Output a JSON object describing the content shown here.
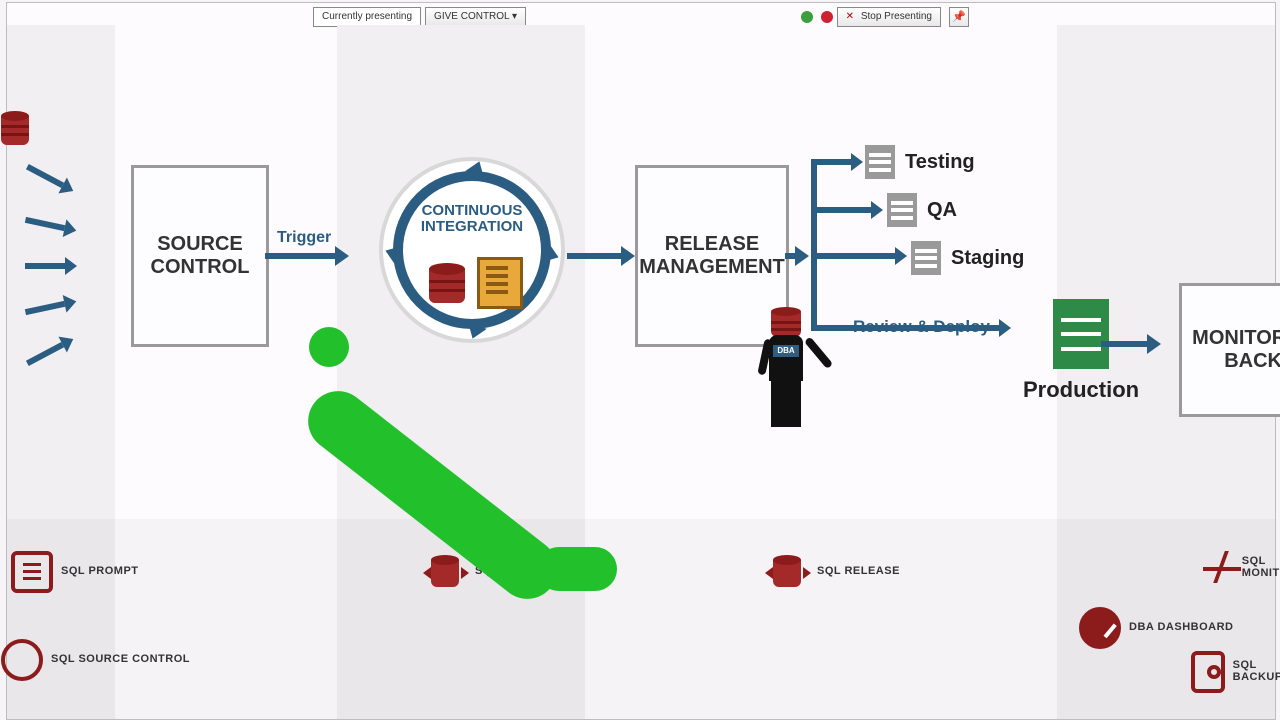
{
  "toolbar": {
    "status": "Currently presenting",
    "give_control": "GIVE CONTROL",
    "stop": "Stop Presenting",
    "close_glyph": "✕",
    "pin_glyph": "📌"
  },
  "labels": {
    "trigger": "Trigger",
    "review_deploy": "Review & Deploy",
    "dba_tag": "DBA"
  },
  "nodes": {
    "source_control": "SOURCE CONTROL",
    "ci_line1": "CONTINUOUS",
    "ci_line2": "INTEGRATION",
    "release_mgmt": "RELEASE MANAGEMENT",
    "monitoring": "MONITORING & BACKUP"
  },
  "envs": {
    "testing": "Testing",
    "qa": "QA",
    "staging": "Staging",
    "production": "Production"
  },
  "tools": {
    "prompt": "SQL PROMPT",
    "source_control": "SQL SOURCE CONTROL",
    "ci": "SQL CI",
    "release": "SQL RELEASE",
    "dashboard": "DBA DASHBOARD",
    "monitor": "SQL MONITOR",
    "backup": "SQL BACKUP"
  },
  "colors": {
    "flow": "#2b5d82",
    "redgate": "#8c1c1c",
    "env_green": "#2e8a47",
    "annotation": "#22c02b"
  }
}
